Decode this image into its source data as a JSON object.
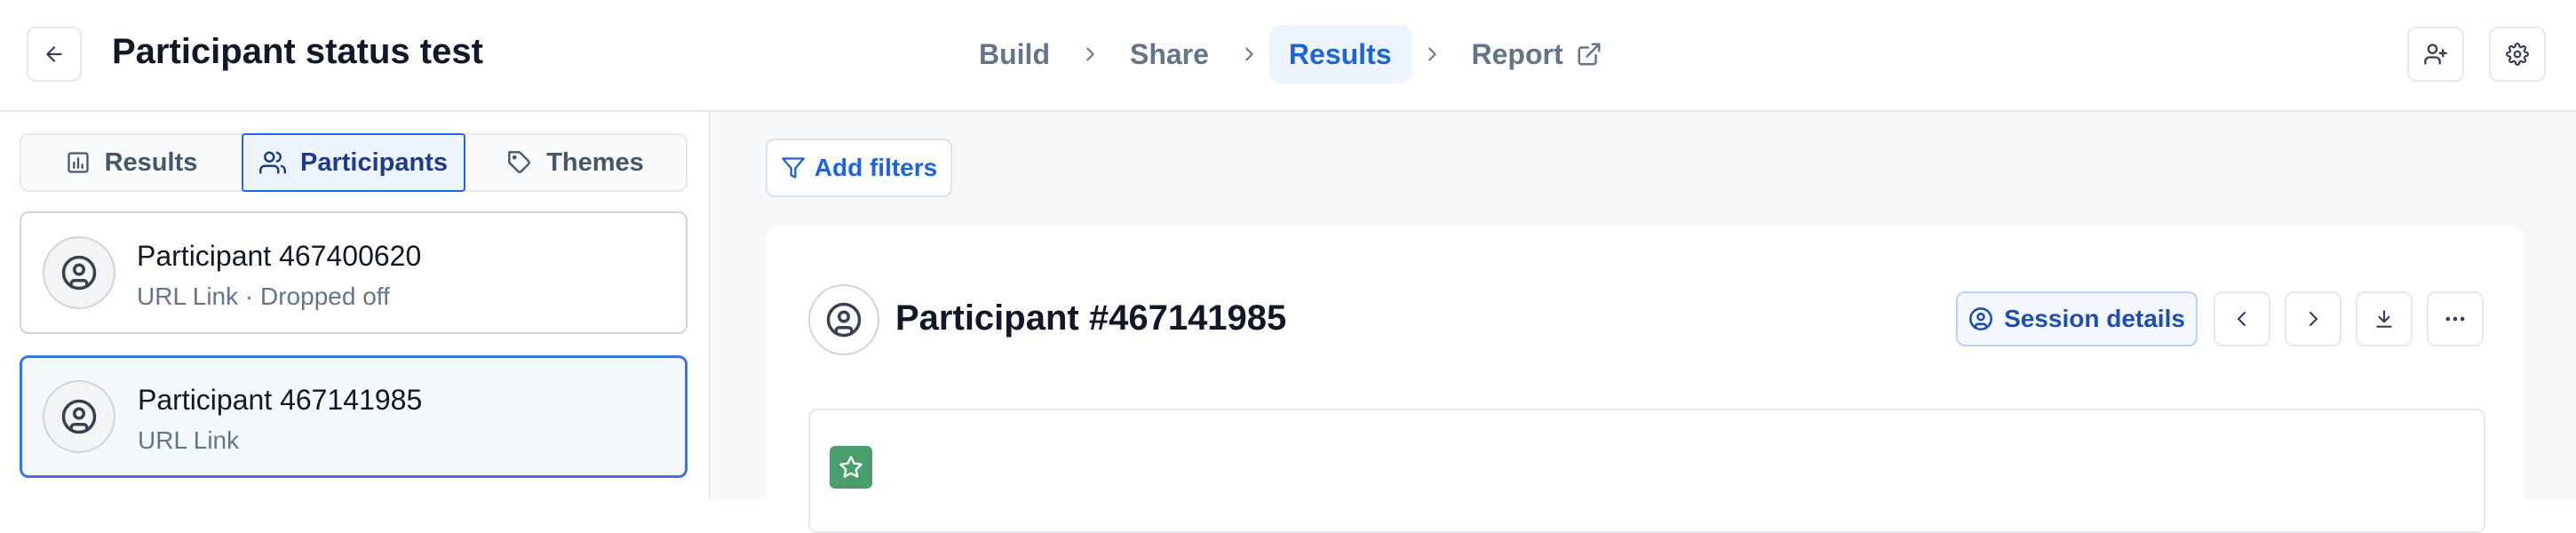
{
  "header": {
    "title": "Participant status test",
    "steps": [
      {
        "label": "Build"
      },
      {
        "label": "Share"
      },
      {
        "label": "Results",
        "active": true
      },
      {
        "label": "Report"
      }
    ]
  },
  "left": {
    "tabs": [
      {
        "label": "Results",
        "icon": "bar-chart-icon"
      },
      {
        "label": "Participants",
        "icon": "users-icon",
        "active": true
      },
      {
        "label": "Themes",
        "icon": "tag-icon"
      }
    ],
    "participants": [
      {
        "name": "Participant 467400620",
        "sub": "URL Link · Dropped off"
      },
      {
        "name": "Participant 467141985",
        "sub": "URL Link",
        "selected": true
      }
    ]
  },
  "main": {
    "filter_label": "Add filters",
    "participant_title": "Participant #467141985",
    "session_details_label": "Session details"
  },
  "colors": {
    "accent": "#1d64d8",
    "selected_bg": "#f4f9fe",
    "star_badge": "#4a9e6b",
    "canvas": "#f7f8fa"
  }
}
